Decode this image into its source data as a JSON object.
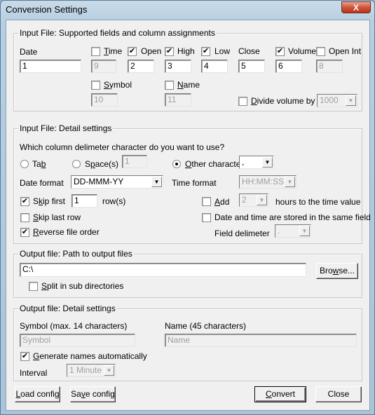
{
  "window": {
    "title": "Conversion Settings",
    "close_label": "X"
  },
  "input_fields": {
    "group_title": "Input File: Supported fields and column assignments",
    "date": {
      "label": "Date",
      "value": "1"
    },
    "time": {
      "label": "Time",
      "checked": false,
      "value": "9"
    },
    "open": {
      "label": "Open",
      "checked": true,
      "value": "2"
    },
    "high": {
      "label": "High",
      "checked": true,
      "value": "3"
    },
    "low": {
      "label": "Low",
      "checked": true,
      "value": "4"
    },
    "close": {
      "label": "Close",
      "value": "5"
    },
    "volume": {
      "label": "Volume",
      "checked": true,
      "value": "6"
    },
    "open_int": {
      "label": "Open Int",
      "checked": false,
      "value": "8"
    },
    "symbol": {
      "label": "Symbol",
      "checked": false,
      "value": "10"
    },
    "name": {
      "label": "Name",
      "checked": false,
      "value": "11"
    },
    "divide_volume": {
      "label": "Divide volume by",
      "checked": false,
      "value": "1000"
    }
  },
  "detail": {
    "group_title": "Input File: Detail settings",
    "question": "Which column delimeter character do you want to use?",
    "tab": {
      "label": "Tab",
      "selected": false
    },
    "space": {
      "label": "Space(s)",
      "selected": false,
      "value": "1"
    },
    "other": {
      "label": "Other character",
      "selected": true,
      "value": ","
    },
    "date_format": {
      "label": "Date format",
      "value": "DD-MMM-YY"
    },
    "time_format": {
      "label": "Time format",
      "value": "HH:MM:SS"
    },
    "skip_first": {
      "label": "Skip first",
      "checked": true,
      "value": "1",
      "suffix": "row(s)"
    },
    "skip_last": {
      "label": "Skip last row",
      "checked": false
    },
    "reverse": {
      "label": "Reverse file order",
      "checked": true
    },
    "add_hours": {
      "label": "Add",
      "checked": false,
      "value": "2",
      "suffix": "hours to the time value"
    },
    "same_field": {
      "label": "Date and time are stored in the same field",
      "checked": false
    },
    "field_delim": {
      "label": "Field delimeter",
      "value": "."
    }
  },
  "output_path": {
    "group_title": "Output file: Path to output files",
    "path": "C:\\",
    "browse_label": "Browse...",
    "split": {
      "label": "Split in sub directories",
      "checked": false
    }
  },
  "output_detail": {
    "group_title": "Output file: Detail settings",
    "symbol_label": "Symbol (max. 14 characters)",
    "symbol_placeholder": "Symbol",
    "name_label": "Name (45 characters)",
    "name_placeholder": "Name",
    "generate": {
      "label": "Generate names automatically",
      "checked": true
    },
    "interval": {
      "label": "Interval",
      "value": "1 Minute"
    }
  },
  "buttons": {
    "load": "Load config",
    "save": "Save config",
    "convert": "Convert",
    "close": "Close"
  }
}
